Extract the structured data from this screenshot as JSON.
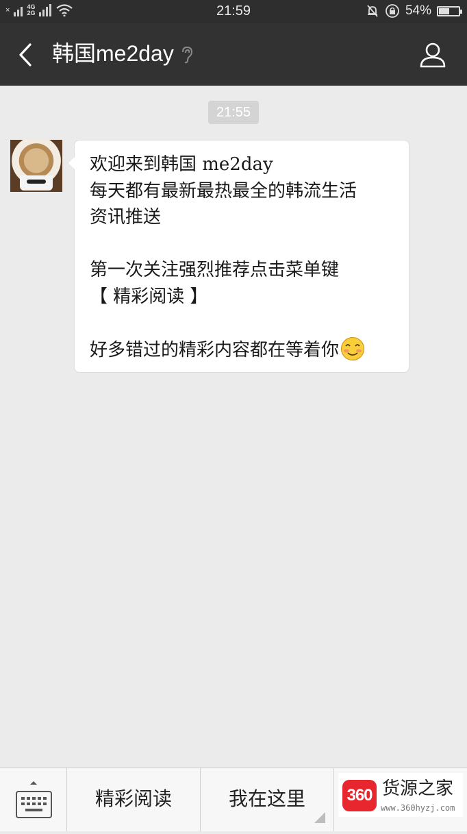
{
  "status_bar": {
    "time": "21:59",
    "network_top": "4G",
    "network_bottom": "2G",
    "battery_percent_label": "54%",
    "battery_level": 0.54
  },
  "header": {
    "title": "韩国me2day",
    "back_icon": "chevron-left-icon",
    "ear_icon": "ear-icon",
    "profile_icon": "person-icon"
  },
  "chat": {
    "timestamp": "21:55",
    "message": {
      "lines": [
        "欢迎来到韩国 me2day",
        "每天都有最新最热最全的韩流生活",
        "资讯推送",
        "",
        "第一次关注强烈推荐点击菜单键",
        "【 精彩阅读 】",
        "",
        "好多错过的精彩内容都在等着你"
      ],
      "emoji": "blushing-smile-emoji"
    }
  },
  "bottom_menu": {
    "keyboard_icon": "keyboard-icon",
    "items": [
      {
        "label": "精彩阅读"
      },
      {
        "label": "我在这里"
      }
    ]
  },
  "watermark": {
    "logo_text": "360",
    "name": "货源之家",
    "url": "www.360hyzj.com"
  },
  "colors": {
    "header_bg": "#323232",
    "status_bg": "#2e2e2e",
    "chat_bg": "#ebebeb",
    "bubble_bg": "#ffffff",
    "watermark_red": "#e8262d"
  }
}
